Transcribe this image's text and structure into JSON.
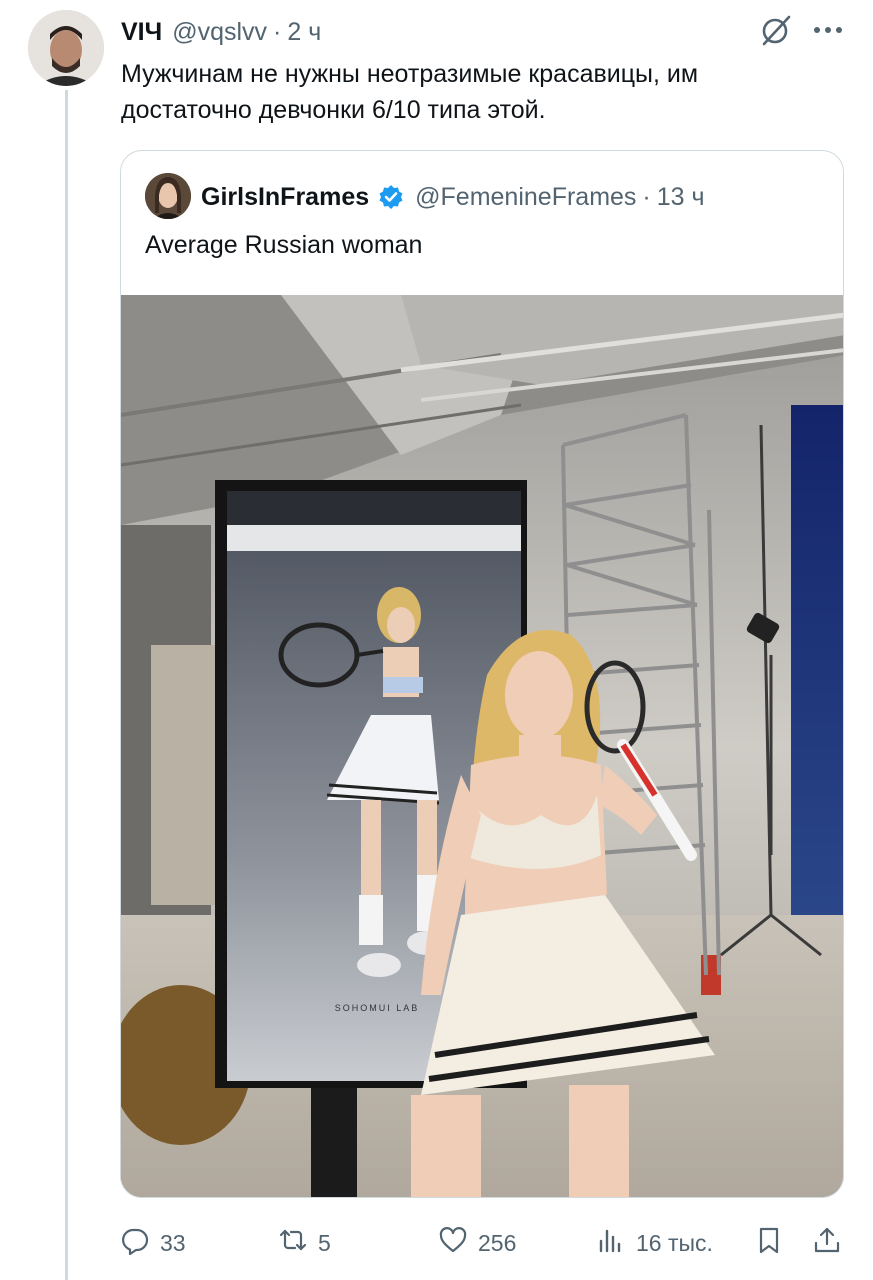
{
  "post": {
    "author_name": "VIЧ",
    "author_handle": "@vqslvv",
    "separator": "·",
    "time": "2 ч",
    "text": "Мужчинам не нужны неотразимые красавицы, им достаточно девчонки 6/10 типа этой."
  },
  "quoted": {
    "author_name": "GirlsInFrames",
    "author_handle": "@FemenineFrames",
    "separator": "·",
    "time": "13 ч",
    "text": "Average Russian woman",
    "media_caption": "SOHOMUI LAB"
  },
  "actions": {
    "replies": "33",
    "reposts": "5",
    "likes": "256",
    "views": "16 тыс."
  },
  "icons": [
    "grok-icon",
    "more-icon",
    "verified-badge-icon",
    "reply-icon",
    "repost-icon",
    "like-icon",
    "views-icon",
    "bookmark-icon",
    "share-icon"
  ],
  "colors": {
    "text": "#0f1419",
    "secondary": "#536471",
    "border": "#cfd9de",
    "verified": "#1d9bf0"
  }
}
